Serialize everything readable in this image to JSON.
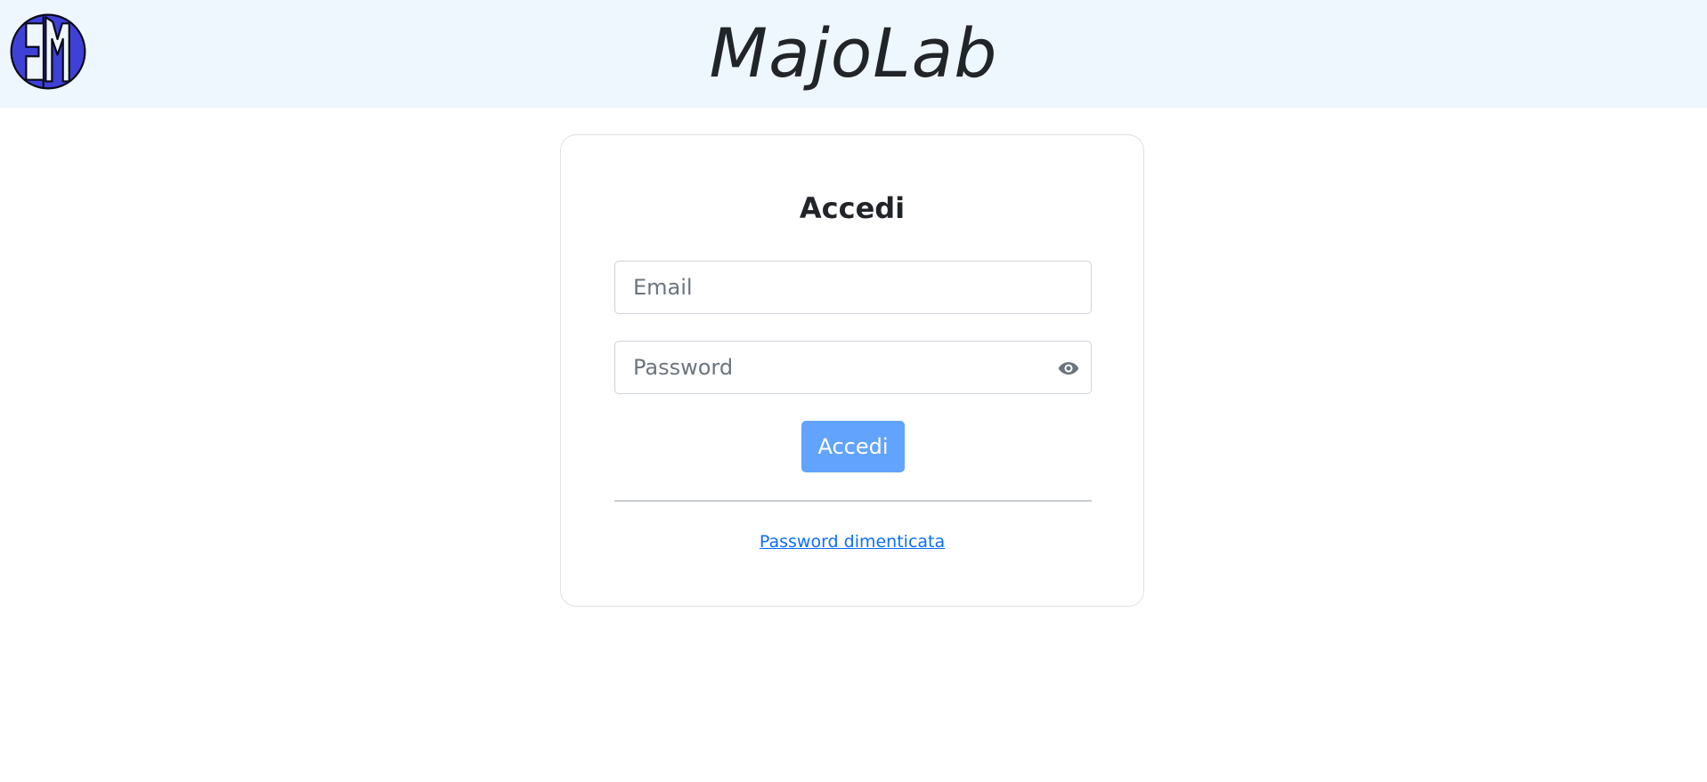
{
  "header": {
    "app_title": "MajoLab",
    "logo_icon": "em-monogram-logo",
    "background": "#eef6fe"
  },
  "login": {
    "title": "Accedi",
    "email_placeholder": "Email",
    "email_value": "",
    "password_placeholder": "Password",
    "password_value": "",
    "password_toggle_icon": "eye-icon",
    "submit_label": "Accedi",
    "forgot_password_label": "Password dimenticata"
  },
  "colors": {
    "accent": "#61a3fd",
    "link": "#0d6efd",
    "logo_fill": "#3f41d6"
  }
}
